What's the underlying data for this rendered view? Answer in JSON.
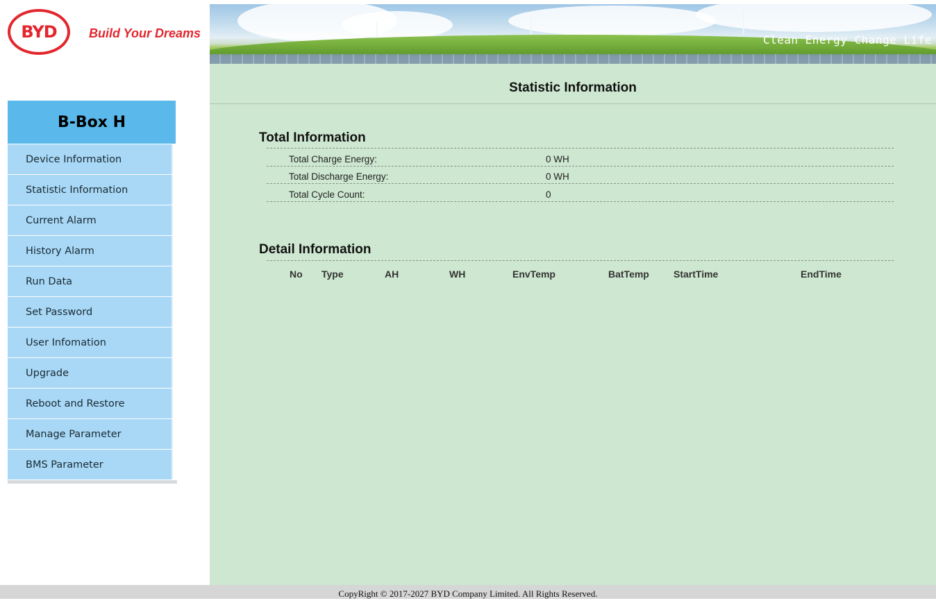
{
  "header": {
    "logo_text": "BYD",
    "logo_slogan": "Build Your Dreams",
    "banner_slogan": "Clean Energy Change Life"
  },
  "sidebar": {
    "title": "B-Box H",
    "items": [
      {
        "label": "Device Information"
      },
      {
        "label": "Statistic Information"
      },
      {
        "label": "Current Alarm"
      },
      {
        "label": "History Alarm"
      },
      {
        "label": "Run Data"
      },
      {
        "label": "Set Password"
      },
      {
        "label": "User Infomation"
      },
      {
        "label": "Upgrade"
      },
      {
        "label": "Reboot and Restore"
      },
      {
        "label": "Manage Parameter"
      },
      {
        "label": "BMS Parameter"
      }
    ]
  },
  "main": {
    "page_title": "Statistic Information",
    "total": {
      "title": "Total Information",
      "rows": [
        {
          "label": "Total Charge Energy:",
          "value": "0  WH"
        },
        {
          "label": "Total Discharge Energy:",
          "value": "0  WH"
        },
        {
          "label": "Total Cycle Count:",
          "value": "0"
        }
      ]
    },
    "detail": {
      "title": "Detail Information",
      "columns": [
        "No",
        "Type",
        "AH",
        "WH",
        "EnvTemp",
        "BatTemp",
        "StartTime",
        "EndTime"
      ]
    }
  },
  "footer": {
    "text": "CopyRight © 2017-2027 BYD Company Limited. All Rights Reserved."
  },
  "colors": {
    "brand_red": "#e3262d",
    "sidebar_title_bg": "#5ab8ea",
    "sidebar_item_bg": "#a8d8f6",
    "content_bg": "#cde7d0",
    "footer_bg": "#d6d6d6"
  }
}
